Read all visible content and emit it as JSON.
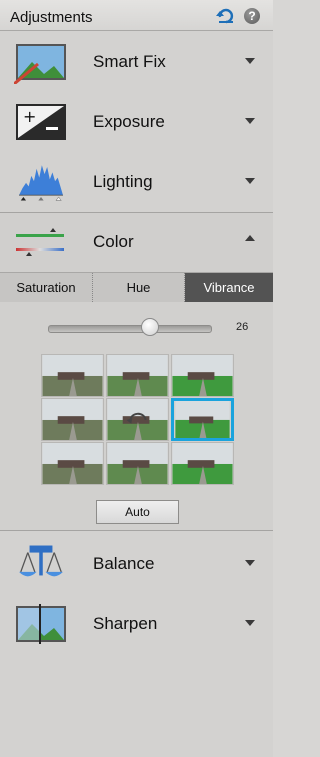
{
  "header": {
    "title": "Adjustments",
    "help_label": "?"
  },
  "items": [
    {
      "label": "Smart Fix",
      "icon": "smart-fix-icon"
    },
    {
      "label": "Exposure",
      "icon": "exposure-icon"
    },
    {
      "label": "Lighting",
      "icon": "lighting-histogram-icon"
    },
    {
      "label": "Color",
      "icon": "color-sliders-icon"
    },
    {
      "label": "Balance",
      "icon": "balance-scale-icon"
    },
    {
      "label": "Sharpen",
      "icon": "sharpen-icon"
    }
  ],
  "color_tabs": [
    {
      "label": "Saturation"
    },
    {
      "label": "Hue"
    },
    {
      "label": "Vibrance",
      "selected": true
    }
  ],
  "slider": {
    "value": "26",
    "fraction": 0.63
  },
  "auto_label": "Auto",
  "colors": {
    "accent": "#1aa3dd",
    "selected_tab": "#535353"
  }
}
